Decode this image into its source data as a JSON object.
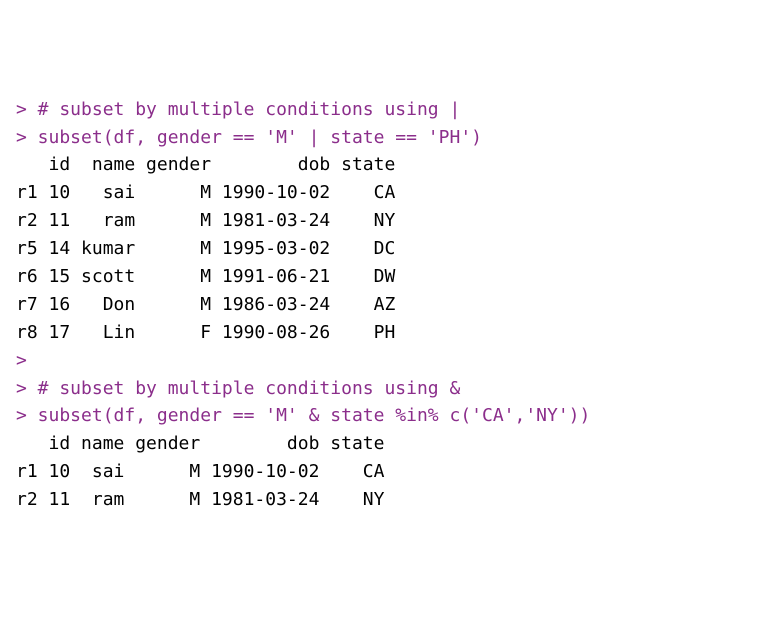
{
  "colors": {
    "prompt": "#8b2e8b",
    "output": "#000000"
  },
  "lines": [
    {
      "kind": "cmd",
      "text": "> # subset by multiple conditions using |"
    },
    {
      "kind": "cmd",
      "text": "> subset(df, gender == 'M' | state == 'PH')"
    },
    {
      "kind": "out",
      "text": "   id  name gender        dob state"
    },
    {
      "kind": "out",
      "text": "r1 10   sai      M 1990-10-02    CA"
    },
    {
      "kind": "out",
      "text": "r2 11   ram      M 1981-03-24    NY"
    },
    {
      "kind": "out",
      "text": "r5 14 kumar      M 1995-03-02    DC"
    },
    {
      "kind": "out",
      "text": "r6 15 scott      M 1991-06-21    DW"
    },
    {
      "kind": "out",
      "text": "r7 16   Don      M 1986-03-24    AZ"
    },
    {
      "kind": "out",
      "text": "r8 17   Lin      F 1990-08-26    PH"
    },
    {
      "kind": "cmd",
      "text": "> "
    },
    {
      "kind": "cmd",
      "text": "> # subset by multiple conditions using &"
    },
    {
      "kind": "cmd",
      "text": "> subset(df, gender == 'M' & state %in% c('CA','NY'))"
    },
    {
      "kind": "out",
      "text": "   id name gender        dob state"
    },
    {
      "kind": "out",
      "text": "r1 10  sai      M 1990-10-02    CA"
    },
    {
      "kind": "out",
      "text": "r2 11  ram      M 1981-03-24    NY"
    }
  ],
  "chart_data": {
    "type": "table",
    "tables": [
      {
        "title": "subset(df, gender == 'M' | state == 'PH')",
        "columns": [
          "row",
          "id",
          "name",
          "gender",
          "dob",
          "state"
        ],
        "rows": [
          [
            "r1",
            10,
            "sai",
            "M",
            "1990-10-02",
            "CA"
          ],
          [
            "r2",
            11,
            "ram",
            "M",
            "1981-03-24",
            "NY"
          ],
          [
            "r5",
            14,
            "kumar",
            "M",
            "1995-03-02",
            "DC"
          ],
          [
            "r6",
            15,
            "scott",
            "M",
            "1991-06-21",
            "DW"
          ],
          [
            "r7",
            16,
            "Don",
            "M",
            "1986-03-24",
            "AZ"
          ],
          [
            "r8",
            17,
            "Lin",
            "F",
            "1990-08-26",
            "PH"
          ]
        ]
      },
      {
        "title": "subset(df, gender == 'M' & state %in% c('CA','NY'))",
        "columns": [
          "row",
          "id",
          "name",
          "gender",
          "dob",
          "state"
        ],
        "rows": [
          [
            "r1",
            10,
            "sai",
            "M",
            "1990-10-02",
            "CA"
          ],
          [
            "r2",
            11,
            "ram",
            "M",
            "1981-03-24",
            "NY"
          ]
        ]
      }
    ]
  }
}
